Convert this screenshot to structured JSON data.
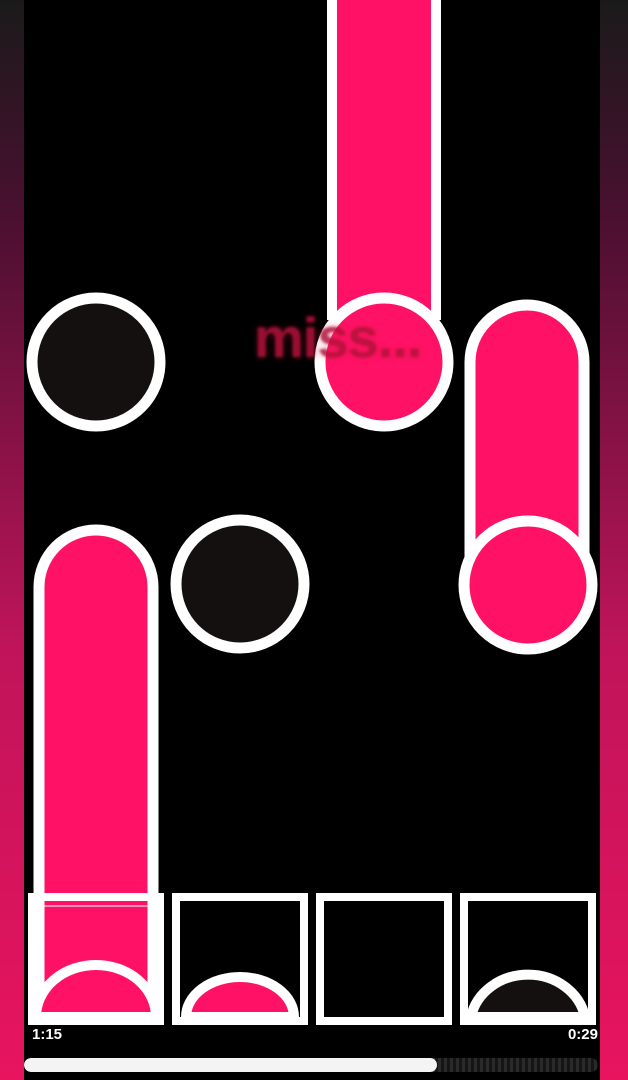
{
  "miss_text": "miss...",
  "timer": {
    "elapsed": "1:15",
    "remaining": "0:29"
  },
  "progress": {
    "fraction": 0.72
  },
  "colors": {
    "note_pink": "#ff1265",
    "note_outline": "#ffffff",
    "background": "#000000",
    "empty_note": "#141010",
    "side_bar_accent": "#e8145e"
  },
  "lanes": [
    {
      "name": "lane-1",
      "state": "holding",
      "hit_arc": "pink"
    },
    {
      "name": "lane-2",
      "state": "idle",
      "hit_arc": "pink"
    },
    {
      "name": "lane-3",
      "state": "idle",
      "hit_arc": "none"
    },
    {
      "name": "lane-4",
      "state": "idle",
      "hit_arc": "dark"
    }
  ]
}
